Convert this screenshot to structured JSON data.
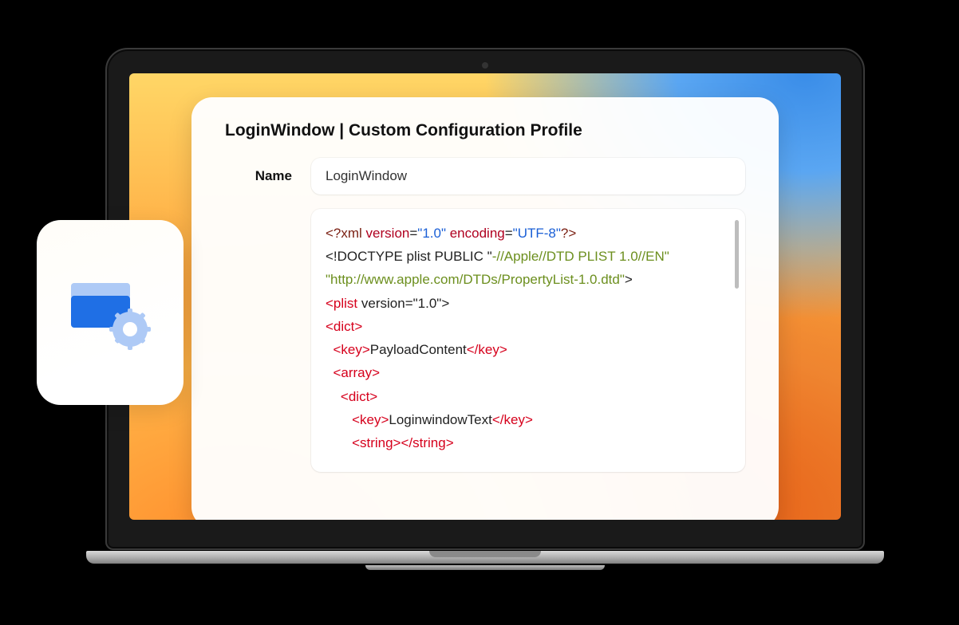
{
  "card": {
    "title": "LoginWindow | Custom Configuration Profile",
    "name_label": "Name",
    "name_value": "LoginWindow"
  },
  "code": {
    "xml_decl_open": "<?xml",
    "xml_version_attr": " version",
    "xml_version_val": "\"1.0\"",
    "xml_encoding_attr": " encoding",
    "xml_encoding_val": "\"UTF-8\"",
    "xml_decl_close": "?>",
    "doctype_pre": "<!DOCTYPE plist PUBLIC \"",
    "doctype_green": "-//Apple//DTD PLIST 1.0//EN\" \"http://www.apple.com/DTDs/PropertyList-1.0.dtd\"",
    "doctype_post": ">",
    "plist_open": "<plist",
    "plist_version_attr": " version=\"1.0\">",
    "dict_open": "<dict>",
    "key_open": "<key>",
    "key_close": "</key>",
    "payload_content": "PayloadContent",
    "array_open": "<array>",
    "loginwindow_text": "LoginwindowText",
    "string_open": "<string>",
    "string_close": "</string>"
  },
  "icons": {
    "config_icon": "config-profile-icon"
  },
  "colors": {
    "tag_red": "#d6001c",
    "attr_red": "#b00020",
    "string_blue": "#1a5fd6",
    "doctype_green": "#6c8f1e"
  }
}
